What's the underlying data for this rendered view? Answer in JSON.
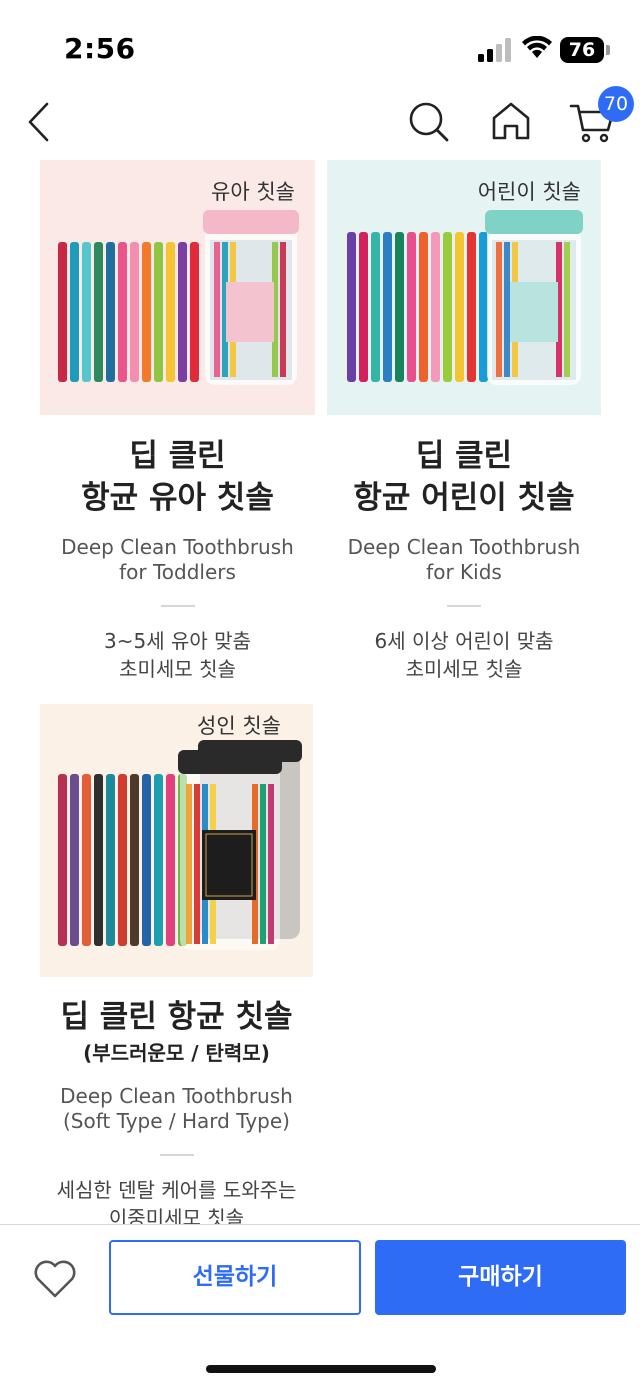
{
  "status_bar": {
    "time": "2:56",
    "battery": "76"
  },
  "header": {
    "cart_count": "70",
    "accent_color": "#2f6cf5"
  },
  "products": [
    {
      "image_tag": "유아 칫솔",
      "title_line1": "딥 클린",
      "title_line2": "항균 유아 칫솔",
      "en_line1": "Deep Clean Toothbrush",
      "en_line2": "for Toddlers",
      "desc_line1": "3~5세 유아 맞춤",
      "desc_line2": "초미세모 칫솔",
      "image_bg": "#fbe9e7",
      "jar_lid_color": "#f4b9c8"
    },
    {
      "image_tag": "어린이 칫솔",
      "title_line1": "딥 클린",
      "title_line2": "항균 어린이 칫솔",
      "en_line1": "Deep Clean Toothbrush",
      "en_line2": "for Kids",
      "desc_line1": "6세 이상 어린이 맞춤",
      "desc_line2": "초미세모 칫솔",
      "image_bg": "#e6f3f3",
      "jar_lid_color": "#7fd3c6"
    },
    {
      "image_tag": "성인 칫솔",
      "title_line1": "딥 클린 항균 칫솔",
      "title_line2": "(부드러운모 / 탄력모)",
      "en_line1": "Deep Clean Toothbrush",
      "en_line2": "(Soft Type / Hard Type)",
      "desc_line1": "세심한 덴탈 케어를 도와주는",
      "desc_line2": "이중미세모 칫솔",
      "image_bg": "#fbf1e6",
      "jar_lid_color": "#2a2a2a"
    }
  ],
  "bottom_bar": {
    "gift_label": "선물하기",
    "buy_label": "구매하기"
  },
  "icons": {
    "back": "chevron-left-icon",
    "search": "search-icon",
    "home": "home-icon",
    "cart": "cart-icon",
    "wishlist": "heart-icon"
  }
}
